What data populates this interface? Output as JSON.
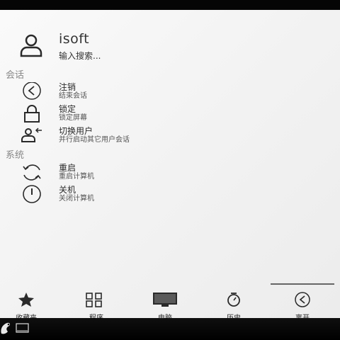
{
  "user": {
    "name": "isoft",
    "search_placeholder": "输入搜索..."
  },
  "sections": [
    {
      "header": "会话",
      "items": [
        {
          "title": "注销",
          "subtitle": "结束会话",
          "icon": "logout-icon"
        },
        {
          "title": "锁定",
          "subtitle": "锁定屏幕",
          "icon": "lock-icon"
        },
        {
          "title": "切换用户",
          "subtitle": "并行启动其它用户会话",
          "icon": "switch-user-icon"
        }
      ]
    },
    {
      "header": "系统",
      "items": [
        {
          "title": "重启",
          "subtitle": "重启计算机",
          "icon": "restart-icon"
        },
        {
          "title": "关机",
          "subtitle": "关闭计算机",
          "icon": "power-icon"
        }
      ]
    }
  ],
  "tabs": [
    {
      "label": "收藏夹",
      "icon": "star-icon"
    },
    {
      "label": "程序",
      "icon": "grid-icon"
    },
    {
      "label": "电脑",
      "icon": "monitor-icon"
    },
    {
      "label": "历史",
      "icon": "history-icon"
    },
    {
      "label": "离开",
      "icon": "leave-icon",
      "active": true
    }
  ],
  "taskbar": {
    "icons": [
      "app-launcher-icon",
      "show-desktop-icon"
    ]
  }
}
